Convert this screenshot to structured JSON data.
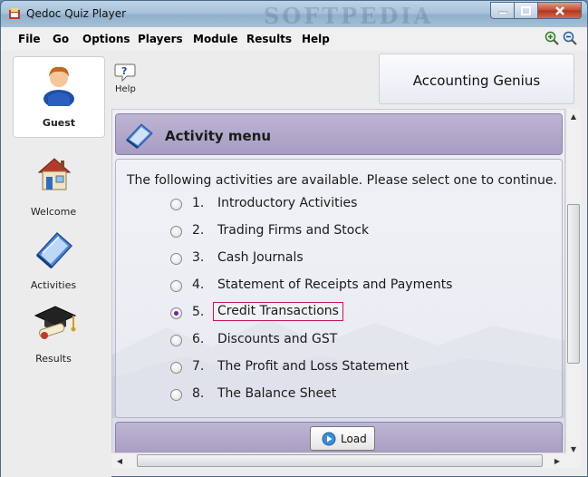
{
  "window": {
    "title": "Qedoc Quiz Player",
    "watermark": "SOFTPEDIA",
    "controls": {
      "minimize": "minimize",
      "maximize": "maximize",
      "close": "close"
    }
  },
  "menubar": {
    "items": [
      "File",
      "Go",
      "Options",
      "Players",
      "Module",
      "Results",
      "Help"
    ],
    "zoom_in_icon": "zoom-in-icon",
    "zoom_out_icon": "zoom-out-icon"
  },
  "sidebar": {
    "user_label": "Guest",
    "items": [
      {
        "label": "Welcome",
        "icon": "house-icon"
      },
      {
        "label": "Activities",
        "icon": "book-icon"
      },
      {
        "label": "Results",
        "icon": "graduation-cap-icon"
      }
    ]
  },
  "toolbar": {
    "help_label": "Help"
  },
  "module_title": "Accounting Genius",
  "activity": {
    "header": "Activity menu",
    "intro": "The following activities are available. Please select one to continue.",
    "options": [
      {
        "num": "1.",
        "label": "Introductory Activities",
        "selected": false
      },
      {
        "num": "2.",
        "label": "Trading Firms and Stock",
        "selected": false
      },
      {
        "num": "3.",
        "label": "Cash Journals",
        "selected": false
      },
      {
        "num": "4.",
        "label": "Statement of Receipts and Payments",
        "selected": false
      },
      {
        "num": "5.",
        "label": "Credit Transactions",
        "selected": true
      },
      {
        "num": "6.",
        "label": "Discounts and GST",
        "selected": false
      },
      {
        "num": "7.",
        "label": "The Profit and Loss Statement",
        "selected": false
      },
      {
        "num": "8.",
        "label": "The Balance Sheet",
        "selected": false
      }
    ],
    "load_label": "Load"
  },
  "colors": {
    "accent_purple": "#a89cc3",
    "selected_radio": "#7b1fa2",
    "selection_outline": "#c2185b",
    "titlebar": "#a9c3da"
  }
}
